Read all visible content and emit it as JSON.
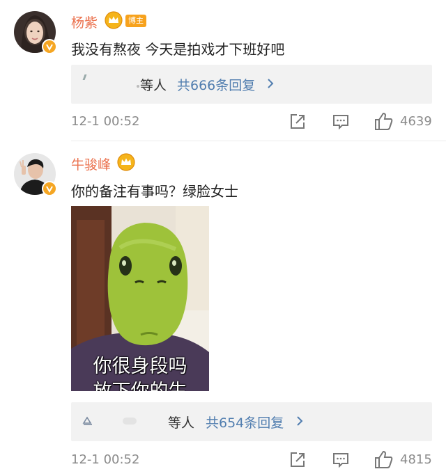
{
  "comments": [
    {
      "username": "杨紫",
      "role_tag": "博主",
      "text": "我没有熬夜 今天是拍戏才下班好吧",
      "replies": {
        "who": "等人",
        "count": "共666条回复"
      },
      "time": "12-1 00:52",
      "likes": "4639"
    },
    {
      "username": "牛骏峰",
      "text": "你的备注有事吗？绿脸女士",
      "meme_caption": [
        "你很身段吗",
        "放下你的生"
      ],
      "replies": {
        "who": "等人",
        "count": "共654条回复"
      },
      "time": "12-1 00:52",
      "likes": "4815"
    }
  ],
  "colors": {
    "username": "#eb7350",
    "link": "#507daf",
    "meta": "#8a8a8a",
    "badge": "#f5a623"
  },
  "icons": [
    "crown-icon",
    "verified-badge-icon",
    "share-icon",
    "comment-icon",
    "like-icon",
    "chevron-right-icon"
  ]
}
